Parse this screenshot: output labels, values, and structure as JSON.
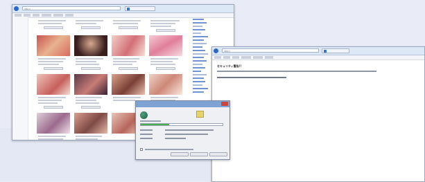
{
  "browser_window": {
    "address": "http://",
    "tab_title": ""
  },
  "dialog": {
    "title": ""
  },
  "warning_window": {
    "address": "http://",
    "heading": "セキュリティ警告!!"
  },
  "colors": {
    "accent": "#2f67c7",
    "progress": "#47b04b",
    "dialog_title": "#7fa2d4"
  },
  "download_progress": 0.35
}
